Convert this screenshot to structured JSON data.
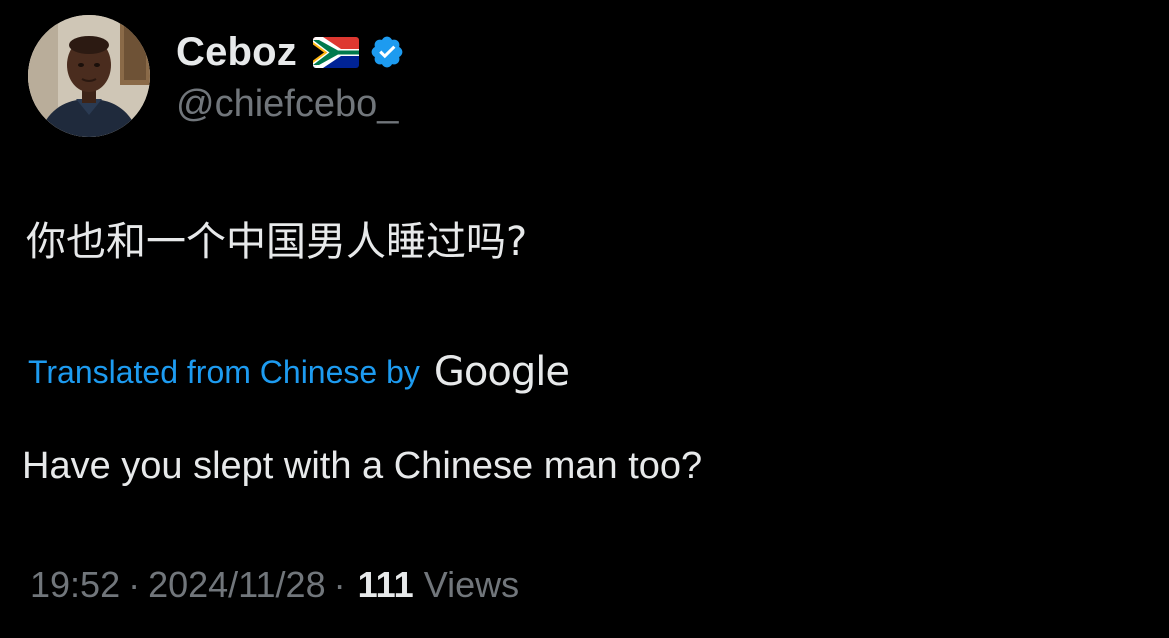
{
  "author": {
    "display_name": "Ceboz",
    "handle": "@chiefcebo_",
    "flag_icon": "south-africa-flag-icon",
    "verified_icon": "verified-badge-icon",
    "verified_color": "#1d9bf0",
    "avatar_icon": "avatar"
  },
  "tweet": {
    "text": "你也和一个中国男人睡过吗?",
    "translation_label": "Translated from Chinese by",
    "translation_provider": "Google",
    "translated_text": "Have you slept with a Chinese man too?"
  },
  "meta": {
    "time": "19:52",
    "separator": "·",
    "date": "2024/11/28",
    "views_count": "111",
    "views_label": "Views"
  },
  "colors": {
    "background": "#000000",
    "primary_text": "#e7e9ea",
    "secondary_text": "#71767b",
    "link": "#1d9bf0"
  }
}
